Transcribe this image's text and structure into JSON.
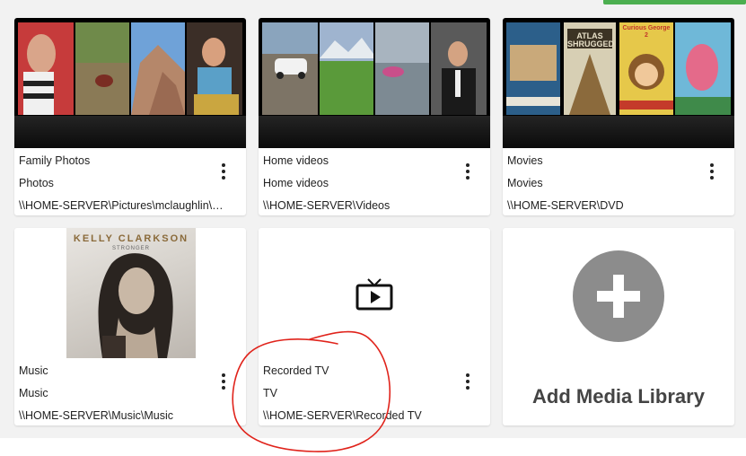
{
  "libraries": [
    {
      "name": "Family Photos",
      "type": "Photos",
      "path": "\\\\HOME-SERVER\\Pictures\\mclaughlin\\Ry..."
    },
    {
      "name": "Home videos",
      "type": "Home videos",
      "path": "\\\\HOME-SERVER\\Videos"
    },
    {
      "name": "Movies",
      "type": "Movies",
      "path": "\\\\HOME-SERVER\\DVD"
    },
    {
      "name": "Music",
      "type": "Music",
      "path": "\\\\HOME-SERVER\\Music\\Music",
      "album_artist": "KELLY CLARKSON",
      "album_title": "STRONGER"
    },
    {
      "name": "Recorded TV",
      "type": "TV",
      "path": "\\\\HOME-SERVER\\Recorded TV"
    }
  ],
  "movie_covers": [
    "ATLAS SHRUGGED",
    "Curious George 2"
  ],
  "add_library": {
    "label": "Add Media Library"
  },
  "icons": {
    "menu": "more-vert-icon",
    "tv": "live-tv-icon",
    "add": "add-circle-icon"
  },
  "colors": {
    "accent_green": "#4caf50",
    "annotation_red": "#e0231b",
    "add_circle": "#8c8c8c"
  }
}
